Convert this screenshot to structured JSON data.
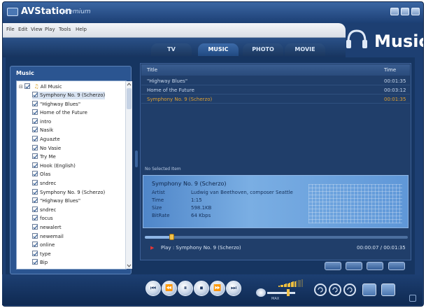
{
  "window": {
    "app_name": "AVStation",
    "app_edition": "premium",
    "section_title": "Music"
  },
  "menu": [
    "File",
    "Edit",
    "View",
    "Play",
    "Tools",
    "Help"
  ],
  "tabs": [
    {
      "label": "TV",
      "active": false
    },
    {
      "label": "MUSIC",
      "active": true
    },
    {
      "label": "PHOTO",
      "active": false
    },
    {
      "label": "MOVIE",
      "active": false
    }
  ],
  "library": {
    "title": "Music",
    "root_label": "All Music",
    "items": [
      {
        "label": "Symphony No. 9 (Scherzo)",
        "selected": true
      },
      {
        "label": "\"Highway Blues\"",
        "selected": false
      },
      {
        "label": "Home of the Future",
        "selected": false
      },
      {
        "label": "intro",
        "selected": false
      },
      {
        "label": "Nasik",
        "selected": false
      },
      {
        "label": "Aguazte",
        "selected": false
      },
      {
        "label": "No Vasie",
        "selected": false
      },
      {
        "label": "Try Me",
        "selected": false
      },
      {
        "label": "Hook (English)",
        "selected": false
      },
      {
        "label": "Olas",
        "selected": false
      },
      {
        "label": "sndrec",
        "selected": false
      },
      {
        "label": "Symphony No. 9 (Scherzo)",
        "selected": false
      },
      {
        "label": "\"Highway Blues\"",
        "selected": false
      },
      {
        "label": "sndrec",
        "selected": false
      },
      {
        "label": "focus",
        "selected": false
      },
      {
        "label": "newalert",
        "selected": false
      },
      {
        "label": "newemail",
        "selected": false
      },
      {
        "label": "online",
        "selected": false
      },
      {
        "label": "type",
        "selected": false
      },
      {
        "label": "Bip",
        "selected": false
      }
    ]
  },
  "playlist": {
    "columns": {
      "title": "Title",
      "time": "Time"
    },
    "rows": [
      {
        "title": "\"Highway Blues\"",
        "time": "00:01:35",
        "current": false
      },
      {
        "title": "Home of the Future",
        "time": "00:03:12",
        "current": false
      },
      {
        "title": "Symphony No. 9 (Scherzo)",
        "time": "00:01:35",
        "current": true
      }
    ]
  },
  "info": {
    "section_label": "No Selected Item",
    "title": "Symphony No. 9 (Scherzo)",
    "fields": [
      {
        "key": "Artist",
        "value": "Ludwig van Beethoven, composer Seattle"
      },
      {
        "key": "Time",
        "value": "1:15"
      },
      {
        "key": "Size",
        "value": "598.1KB"
      },
      {
        "key": "BitRate",
        "value": "64 Kbps"
      }
    ]
  },
  "playback": {
    "status": "Play : Symphony No. 9 (Scherzo)",
    "time": "00:00:07 / 00:01:35",
    "progress": 0.1
  },
  "volume": {
    "value_label": "MAX",
    "level": 0.7
  },
  "colors": {
    "window_bg": "#1d3f72",
    "accent_gold": "#e0a030",
    "info_blue": "#6ea3e0",
    "progress_knob": "#f2c24b"
  },
  "icons": {
    "transport": [
      "previous-icon",
      "rewind-icon",
      "pause-icon",
      "stop-icon",
      "forward-icon",
      "next-icon"
    ],
    "repeat": [
      "repeat-icon",
      "repeat-one-icon",
      "shuffle-icon"
    ]
  }
}
